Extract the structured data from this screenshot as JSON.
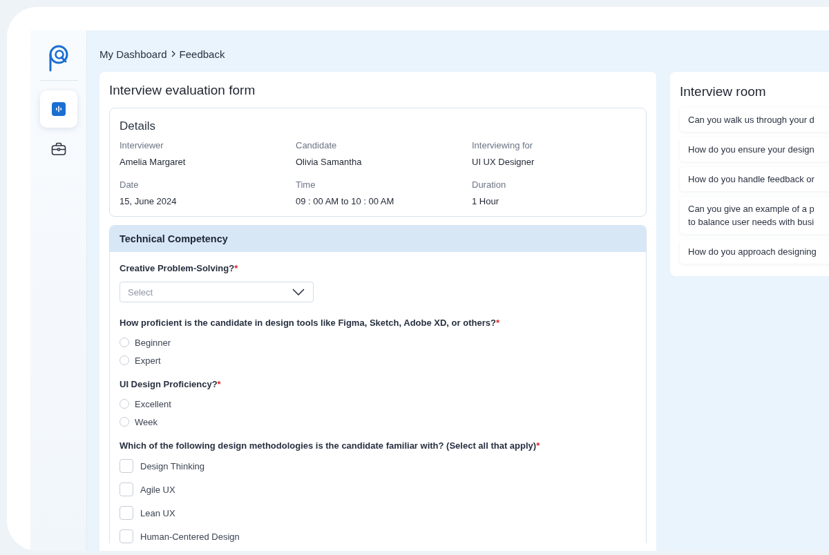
{
  "breadcrumb": [
    {
      "label": "My Dashboard"
    },
    {
      "label": "Feedback"
    }
  ],
  "sidebar": {
    "items": [
      {
        "kind": "interview",
        "selected": true
      },
      {
        "kind": "briefcase",
        "selected": false
      }
    ]
  },
  "form": {
    "title": "Interview evaluation form",
    "details": {
      "title": "Details",
      "fields": [
        {
          "label": "Interviewer",
          "value": "Amelia Margaret"
        },
        {
          "label": "Candidate",
          "value": "Olivia Samantha"
        },
        {
          "label": "Interviewing for",
          "value": "UI UX Designer"
        },
        {
          "label": "Date",
          "value": "15, June 2024"
        },
        {
          "label": "Time",
          "value": "09 : 00 AM to 10 : 00 AM"
        },
        {
          "label": "Duration",
          "value": "1 Hour"
        }
      ]
    },
    "section": {
      "title": "Technical Competency",
      "questions": [
        {
          "kind": "select",
          "label": "Creative Problem-Solving?",
          "required_mark": "*",
          "placeholder": "Select"
        },
        {
          "kind": "radio",
          "label": "How proficient is the candidate in design tools like Figma, Sketch, Adobe XD, or others?",
          "required_mark": "*",
          "options": [
            {
              "label": "Beginner",
              "selected": false
            },
            {
              "label": "Expert",
              "selected": false
            }
          ]
        },
        {
          "kind": "radio",
          "label": "UI Design Proficiency?",
          "required_mark": "*",
          "options": [
            {
              "label": "Excellent",
              "selected": false
            },
            {
              "label": "Week",
              "selected": false
            }
          ]
        },
        {
          "kind": "checkbox",
          "label": "Which of the following design methodologies is the candidate familiar with? (Select all that apply)",
          "required_mark": "*",
          "options": [
            {
              "label": "Design Thinking",
              "checked": false
            },
            {
              "label": "Agile UX",
              "checked": false
            },
            {
              "label": "Lean UX",
              "checked": false
            },
            {
              "label": "Human-Centered Design",
              "checked": false
            }
          ]
        }
      ]
    }
  },
  "interview_room": {
    "title": "Interview room",
    "questions": [
      {
        "lines": [
          "Can you walk us through your d"
        ]
      },
      {
        "lines": [
          "How do you ensure your design"
        ]
      },
      {
        "lines": [
          "How do you handle feedback or"
        ]
      },
      {
        "lines": [
          "Can you give an example of a p",
          "to balance user needs with busi"
        ]
      },
      {
        "lines": [
          "How do you approach designing"
        ]
      }
    ]
  }
}
